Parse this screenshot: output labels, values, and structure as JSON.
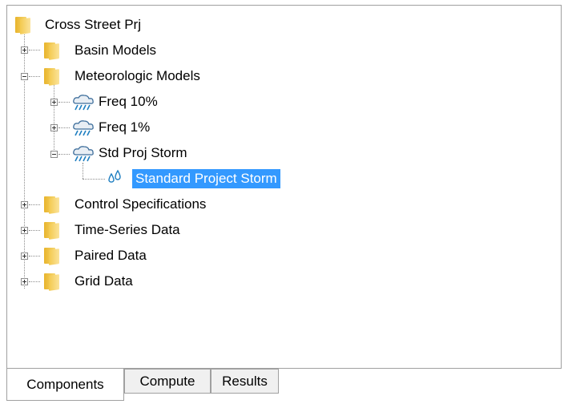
{
  "tree": {
    "root_label": "Cross Street Prj",
    "basin_models_label": "Basin Models",
    "meteorologic_models_label": "Meteorologic Models",
    "freq10_label": "Freq 10%",
    "freq1_label": "Freq 1%",
    "std_proj_storm_label": "Std Proj Storm",
    "standard_project_storm_label": "Standard Project Storm",
    "control_specifications_label": "Control Specifications",
    "time_series_data_label": "Time-Series Data",
    "paired_data_label": "Paired Data",
    "grid_data_label": "Grid Data"
  },
  "tabs": {
    "components_label": "Components",
    "compute_label": "Compute",
    "results_label": "Results"
  },
  "colors": {
    "selection": "#3399ff",
    "folder": "#f3c94e",
    "rain": "#1f7fc1"
  },
  "icons": {
    "folder": "folder-icon",
    "meteorologic": "rain-cloud-icon",
    "precipitation": "water-drops-icon"
  }
}
